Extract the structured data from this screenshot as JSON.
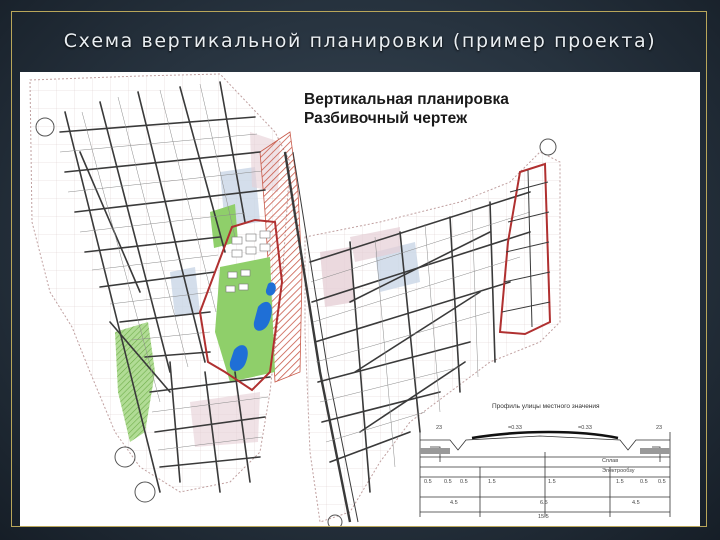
{
  "slide": {
    "title": "Схема вертикальной планировки (пример проекта)"
  },
  "drawing": {
    "heading_line1": "Вертикальная планировка",
    "heading_line2": "Разбивочный чертеж"
  },
  "profile": {
    "title": "Профиль улицы местного значения",
    "dim_top_left": "23",
    "dim_top_mid_left": "=0.33",
    "dim_top_mid_right": "=0.33",
    "dim_top_right": "23",
    "label_curb": "Сплав",
    "label_drain": "Электрообзу",
    "dims_row1": [
      "0.5",
      "0.5",
      "0.5",
      "1.5",
      "1.5",
      "1.5",
      "0.5",
      "0.5"
    ],
    "dims_row2": [
      "4.5",
      "6.5",
      "4.5"
    ],
    "dims_row3": [
      "15.5"
    ]
  },
  "colors": {
    "street_network": "#3a3a3a",
    "main_road": "#b03030",
    "green_area": "#8fcf6a",
    "water": "#1f6fd6",
    "park_hatch": "#c85a4a",
    "block_fill": "#ece8e6",
    "light_blue_zone": "#c9d6e6",
    "pink_zone": "#e6cfd6",
    "boundary_line": "#c0a0a0"
  }
}
